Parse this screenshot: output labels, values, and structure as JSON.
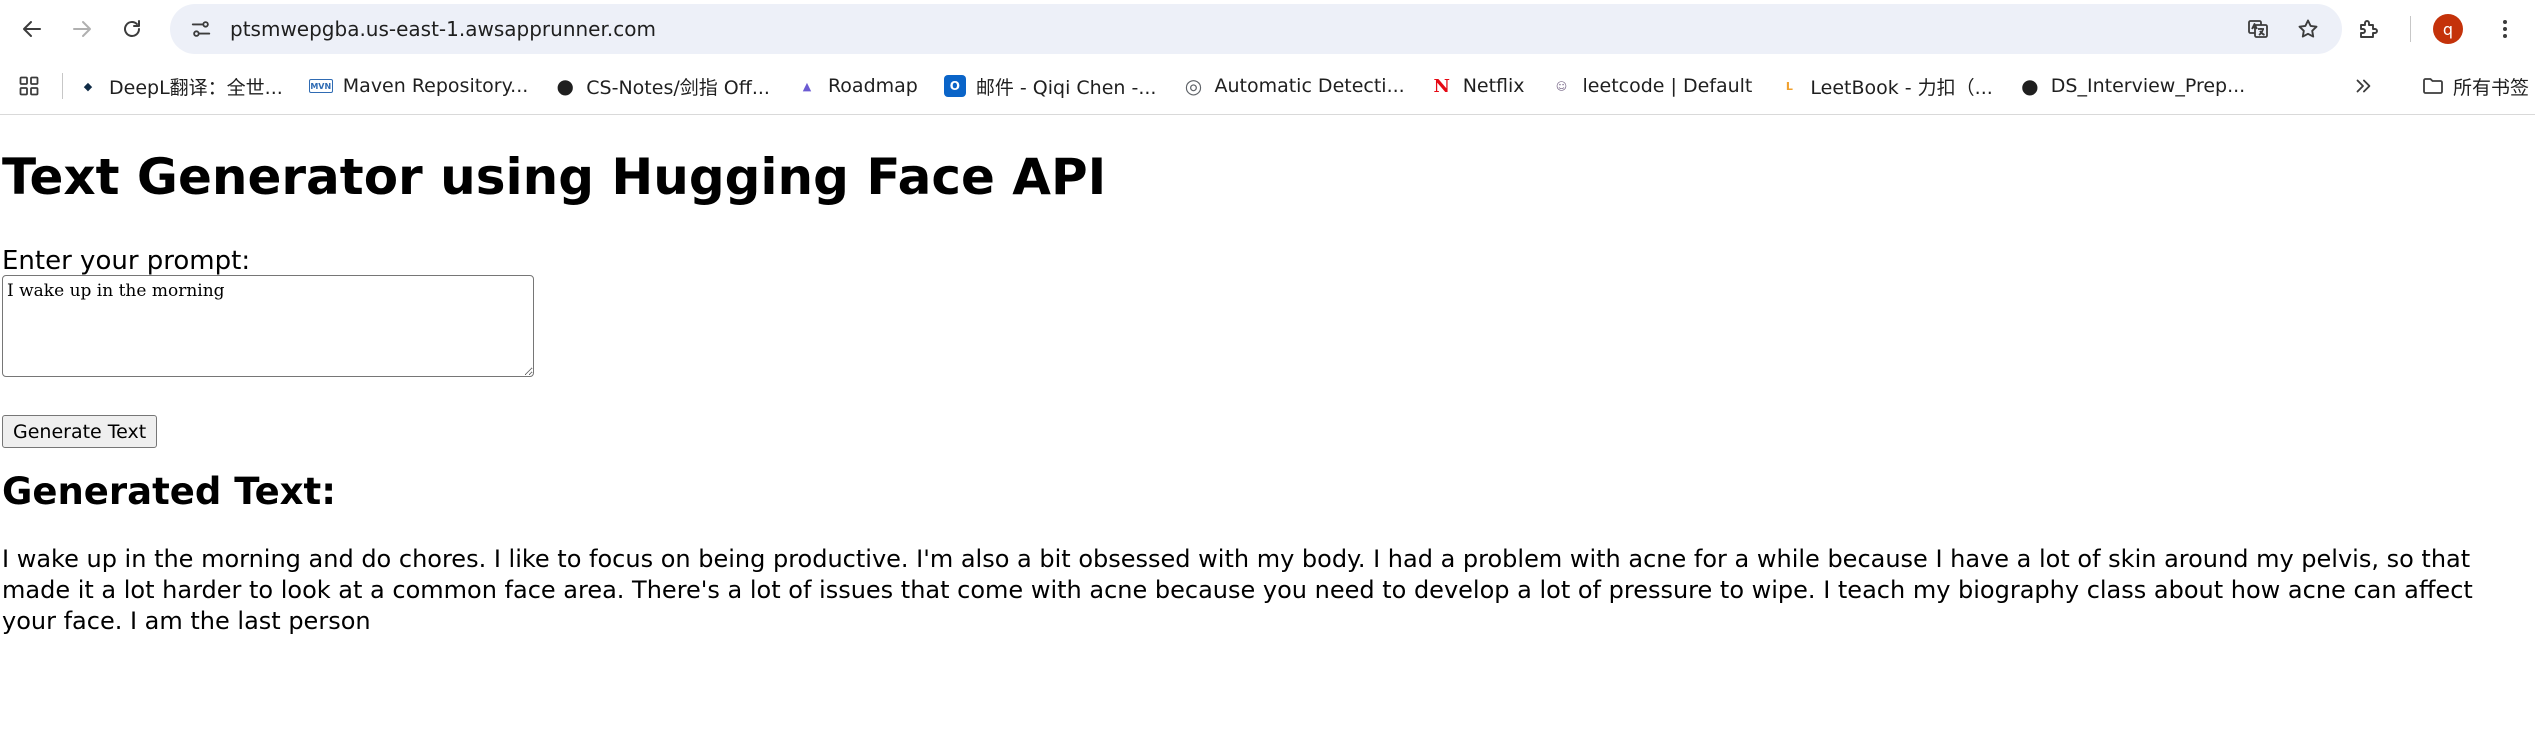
{
  "browser": {
    "url": "ptsmwepgba.us-east-1.awsapprunner.com",
    "profile_initial": "q",
    "bookmarks": [
      {
        "label": "DeepL翻译：全世...",
        "icon": "deepl-icon",
        "color": "#0f2b46"
      },
      {
        "label": "Maven Repository...",
        "icon": "maven-icon",
        "color": "#2f6bb3"
      },
      {
        "label": "CS-Notes/剑指 Off...",
        "icon": "github-icon",
        "color": "#1f1f1f"
      },
      {
        "label": "Roadmap",
        "icon": "rocket-icon",
        "color": "#6b5bd2"
      },
      {
        "label": "邮件 - Qiqi Chen -...",
        "icon": "outlook-icon",
        "color": "#0a64c8"
      },
      {
        "label": "Automatic Detecti...",
        "icon": "globe-icon",
        "color": "#5f6368"
      },
      {
        "label": "Netflix",
        "icon": "netflix-icon",
        "color": "#e50914"
      },
      {
        "label": "leetcode | Default",
        "icon": "leetcode-user-icon",
        "color": "#7a6a8a"
      },
      {
        "label": "LeetBook - 力扣（...",
        "icon": "leetcode-icon",
        "color": "#f0a02e"
      },
      {
        "label": "DS_Interview_Prep...",
        "icon": "github-icon",
        "color": "#1f1f1f"
      }
    ],
    "all_bookmarks_label": "所有书签"
  },
  "page": {
    "title": "Text Generator using Hugging Face API",
    "prompt_label": "Enter your prompt:",
    "prompt_value": "I wake up in the morning",
    "button_label": "Generate Text",
    "result_heading": "Generated Text:",
    "result_text": "I wake up in the morning and do chores. I like to focus on being productive. I'm also a bit obsessed with my body. I had a problem with acne for a while because I have a lot of skin around my pelvis, so that made it a lot harder to look at a common face area. There's a lot of issues that come with acne because you need to develop a lot of pressure to wipe. I teach my biography class about how acne can affect your face. I am the last person"
  }
}
